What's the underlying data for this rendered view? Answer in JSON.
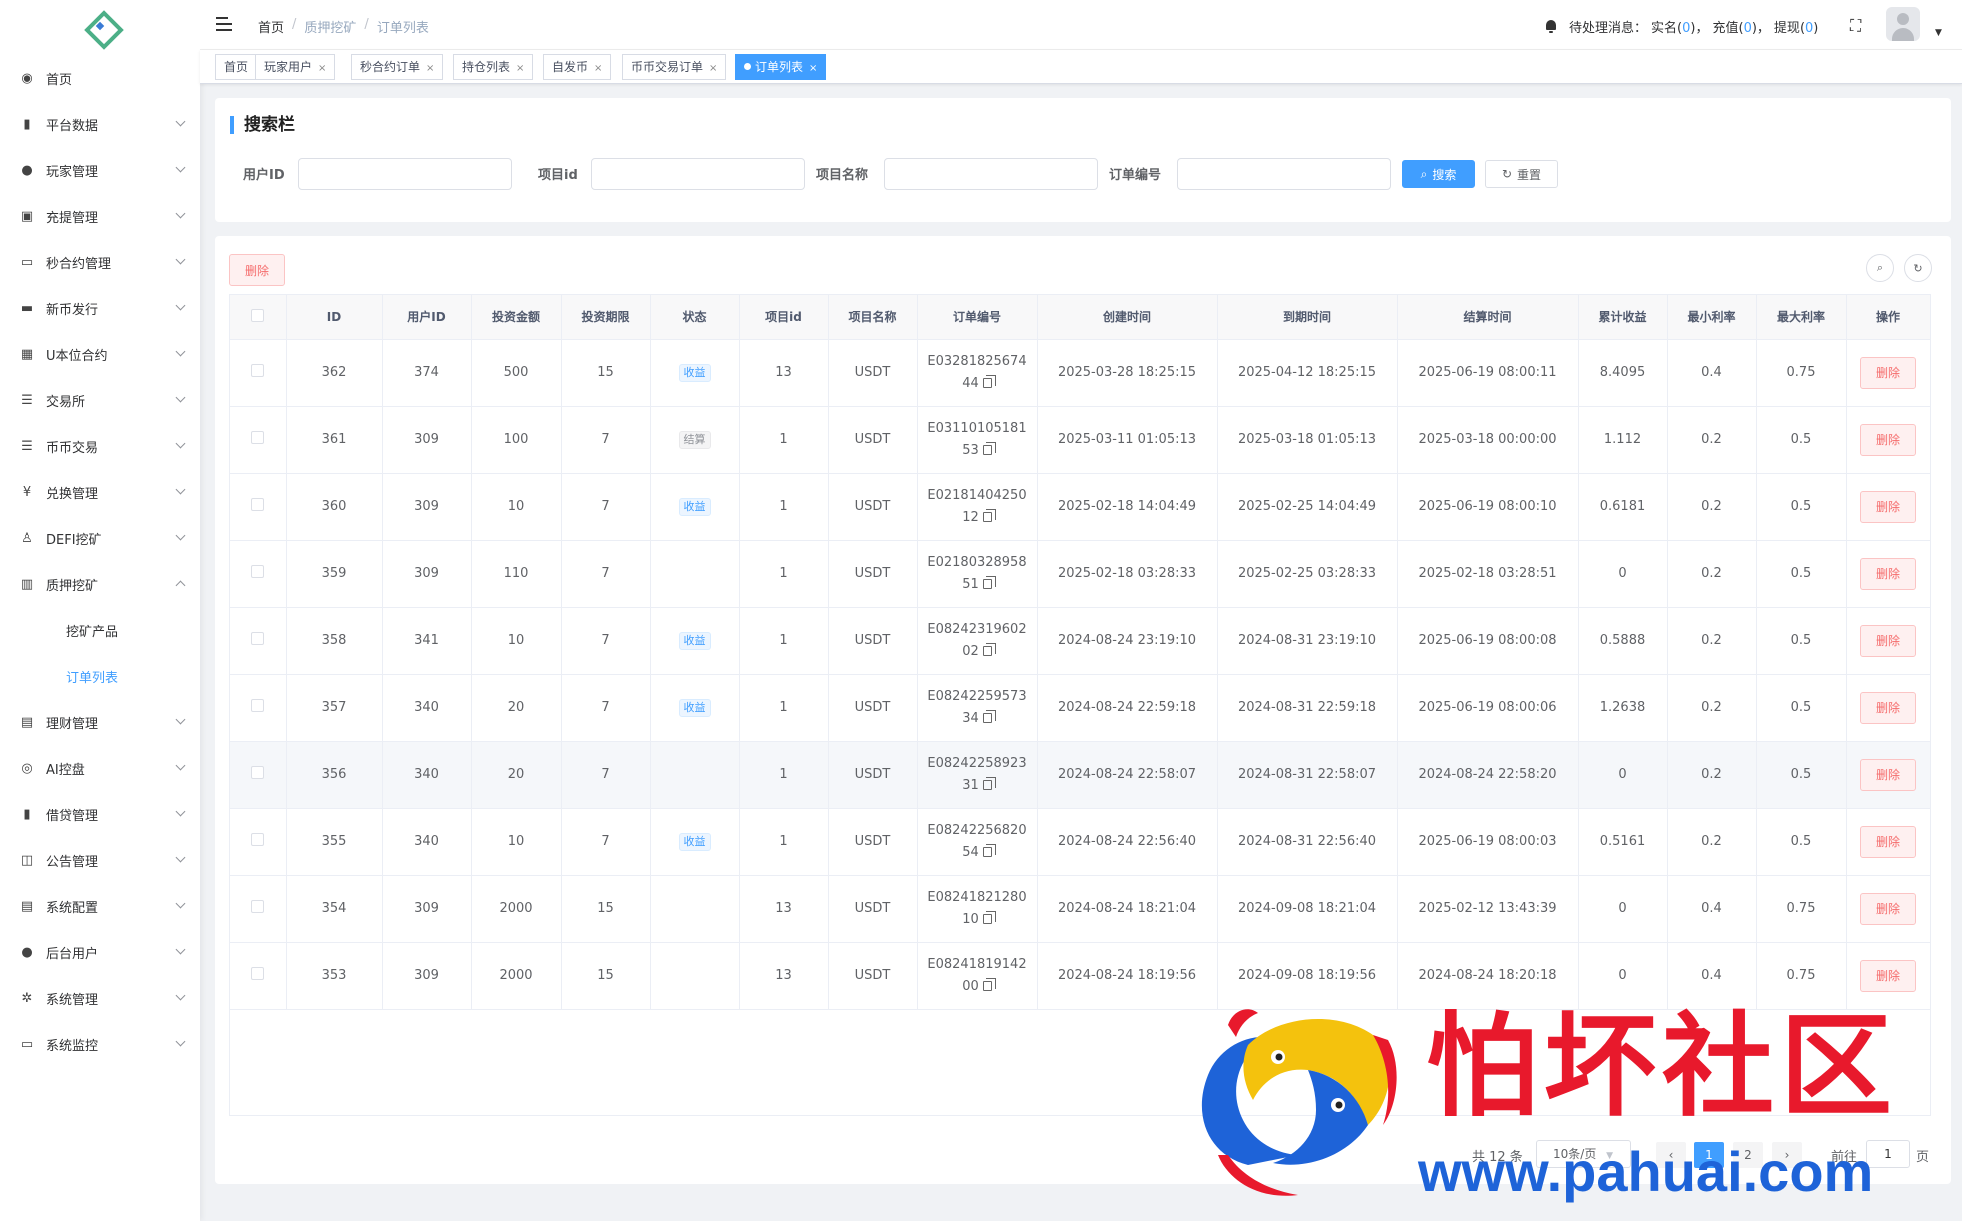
{
  "sidebar": {
    "items": [
      {
        "label": "首页",
        "icon": "dashboard-icon",
        "glyph": "◉",
        "expandable": false
      },
      {
        "label": "平台数据",
        "icon": "book-icon",
        "glyph": "▮",
        "expandable": true
      },
      {
        "label": "玩家管理",
        "icon": "user-icon",
        "glyph": "●",
        "expandable": true
      },
      {
        "label": "充提管理",
        "icon": "copy-icon",
        "glyph": "▣",
        "expandable": true
      },
      {
        "label": "秒合约管理",
        "icon": "monitor-icon",
        "glyph": "▭",
        "expandable": true
      },
      {
        "label": "新币发行",
        "icon": "money-icon",
        "glyph": "▬",
        "expandable": true
      },
      {
        "label": "U本位合约",
        "icon": "grid-icon",
        "glyph": "▦",
        "expandable": true
      },
      {
        "label": "交易所",
        "icon": "list-icon",
        "glyph": "☰",
        "expandable": true
      },
      {
        "label": "币币交易",
        "icon": "list-icon",
        "glyph": "☰",
        "expandable": true
      },
      {
        "label": "兑换管理",
        "icon": "yen-icon",
        "glyph": "¥",
        "expandable": true
      },
      {
        "label": "DEFI挖矿",
        "icon": "user-group-icon",
        "glyph": "♙",
        "expandable": true
      },
      {
        "label": "质押挖矿",
        "icon": "bar-chart-icon",
        "glyph": "▥",
        "expandable": true,
        "open": true
      }
    ],
    "sub_items": [
      {
        "label": "挖矿产品",
        "active": false
      },
      {
        "label": "订单列表",
        "active": true
      }
    ],
    "items_after": [
      {
        "label": "理财管理",
        "icon": "document-icon",
        "glyph": "▤",
        "expandable": true
      },
      {
        "label": "AI控盘",
        "icon": "robot-icon",
        "glyph": "◎",
        "expandable": true
      },
      {
        "label": "借贷管理",
        "icon": "book-icon",
        "glyph": "▮",
        "expandable": true
      },
      {
        "label": "公告管理",
        "icon": "open-book-icon",
        "glyph": "◫",
        "expandable": true
      },
      {
        "label": "系统配置",
        "icon": "document-icon",
        "glyph": "▤",
        "expandable": true
      },
      {
        "label": "后台用户",
        "icon": "users-icon",
        "glyph": "●",
        "expandable": true
      },
      {
        "label": "系统管理",
        "icon": "gear-icon",
        "glyph": "✲",
        "expandable": true
      },
      {
        "label": "系统监控",
        "icon": "monitor-icon",
        "glyph": "▭",
        "expandable": true
      }
    ]
  },
  "header": {
    "breadcrumb": [
      "首页",
      "质押挖矿",
      "订单列表"
    ],
    "pending_label": "待处理消息：",
    "pending_items": [
      {
        "label": "实名",
        "count": "0"
      },
      {
        "label": "充值",
        "count": "0"
      },
      {
        "label": "提现",
        "count": "0"
      }
    ]
  },
  "tags": [
    {
      "label": "首页",
      "closable": false,
      "active": false
    },
    {
      "label": "玩家用户",
      "closable": true,
      "active": false
    },
    {
      "label": "秒合约订单",
      "closable": true,
      "active": false
    },
    {
      "label": "持仓列表",
      "closable": true,
      "active": false
    },
    {
      "label": "自发币",
      "closable": true,
      "active": false
    },
    {
      "label": "币币交易订单",
      "closable": true,
      "active": false
    },
    {
      "label": "订单列表",
      "closable": true,
      "active": true
    }
  ],
  "search": {
    "title": "搜索栏",
    "fields": [
      {
        "label": "用户ID",
        "value": ""
      },
      {
        "label": "项目id",
        "value": ""
      },
      {
        "label": "项目名称",
        "value": ""
      },
      {
        "label": "订单编号",
        "value": ""
      }
    ],
    "search_label": "搜索",
    "reset_label": "重置"
  },
  "toolbar": {
    "delete_label": "删除"
  },
  "table": {
    "columns": [
      "ID",
      "用户ID",
      "投资金额",
      "投资期限",
      "状态",
      "项目id",
      "项目名称",
      "订单编号",
      "创建时间",
      "到期时间",
      "结算时间",
      "累计收益",
      "最小利率",
      "最大利率",
      "操作"
    ],
    "action_label": "删除",
    "rows": [
      {
        "id": "362",
        "user_id": "374",
        "amount": "500",
        "term": "15",
        "status": "收益",
        "status_type": "income",
        "project_id": "13",
        "project_name": "USDT",
        "order_no_1": "E03281825674",
        "order_no_2": "44",
        "created": "2025-03-28 18:25:15",
        "expires": "2025-04-12 18:25:15",
        "settled": "2025-06-19 08:00:11",
        "profit": "8.4095",
        "min_rate": "0.4",
        "max_rate": "0.75"
      },
      {
        "id": "361",
        "user_id": "309",
        "amount": "100",
        "term": "7",
        "status": "结算",
        "status_type": "settle",
        "project_id": "1",
        "project_name": "USDT",
        "order_no_1": "E03110105181",
        "order_no_2": "53",
        "created": "2025-03-11 01:05:13",
        "expires": "2025-03-18 01:05:13",
        "settled": "2025-03-18 00:00:00",
        "profit": "1.112",
        "min_rate": "0.2",
        "max_rate": "0.5"
      },
      {
        "id": "360",
        "user_id": "309",
        "amount": "10",
        "term": "7",
        "status": "收益",
        "status_type": "income",
        "project_id": "1",
        "project_name": "USDT",
        "order_no_1": "E02181404250",
        "order_no_2": "12",
        "created": "2025-02-18 14:04:49",
        "expires": "2025-02-25 14:04:49",
        "settled": "2025-06-19 08:00:10",
        "profit": "0.6181",
        "min_rate": "0.2",
        "max_rate": "0.5"
      },
      {
        "id": "359",
        "user_id": "309",
        "amount": "110",
        "term": "7",
        "status": "",
        "status_type": "",
        "project_id": "1",
        "project_name": "USDT",
        "order_no_1": "E02180328958",
        "order_no_2": "51",
        "created": "2025-02-18 03:28:33",
        "expires": "2025-02-25 03:28:33",
        "settled": "2025-02-18 03:28:51",
        "profit": "0",
        "min_rate": "0.2",
        "max_rate": "0.5"
      },
      {
        "id": "358",
        "user_id": "341",
        "amount": "10",
        "term": "7",
        "status": "收益",
        "status_type": "income",
        "project_id": "1",
        "project_name": "USDT",
        "order_no_1": "E08242319602",
        "order_no_2": "02",
        "created": "2024-08-24 23:19:10",
        "expires": "2024-08-31 23:19:10",
        "settled": "2025-06-19 08:00:08",
        "profit": "0.5888",
        "min_rate": "0.2",
        "max_rate": "0.5"
      },
      {
        "id": "357",
        "user_id": "340",
        "amount": "20",
        "term": "7",
        "status": "收益",
        "status_type": "income",
        "project_id": "1",
        "project_name": "USDT",
        "order_no_1": "E08242259573",
        "order_no_2": "34",
        "created": "2024-08-24 22:59:18",
        "expires": "2024-08-31 22:59:18",
        "settled": "2025-06-19 08:00:06",
        "profit": "1.2638",
        "min_rate": "0.2",
        "max_rate": "0.5"
      },
      {
        "id": "356",
        "user_id": "340",
        "amount": "20",
        "term": "7",
        "status": "",
        "status_type": "",
        "project_id": "1",
        "project_name": "USDT",
        "order_no_1": "E08242258923",
        "order_no_2": "31",
        "created": "2024-08-24 22:58:07",
        "expires": "2024-08-31 22:58:07",
        "settled": "2024-08-24 22:58:20",
        "profit": "0",
        "min_rate": "0.2",
        "max_rate": "0.5",
        "hover": true
      },
      {
        "id": "355",
        "user_id": "340",
        "amount": "10",
        "term": "7",
        "status": "收益",
        "status_type": "income",
        "project_id": "1",
        "project_name": "USDT",
        "order_no_1": "E08242256820",
        "order_no_2": "54",
        "created": "2024-08-24 22:56:40",
        "expires": "2024-08-31 22:56:40",
        "settled": "2025-06-19 08:00:03",
        "profit": "0.5161",
        "min_rate": "0.2",
        "max_rate": "0.5"
      },
      {
        "id": "354",
        "user_id": "309",
        "amount": "2000",
        "term": "15",
        "status": "",
        "status_type": "",
        "project_id": "13",
        "project_name": "USDT",
        "order_no_1": "E08241821280",
        "order_no_2": "10",
        "created": "2024-08-24 18:21:04",
        "expires": "2024-09-08 18:21:04",
        "settled": "2025-02-12 13:43:39",
        "profit": "0",
        "min_rate": "0.4",
        "max_rate": "0.75"
      },
      {
        "id": "353",
        "user_id": "309",
        "amount": "2000",
        "term": "15",
        "status": "",
        "status_type": "",
        "project_id": "13",
        "project_name": "USDT",
        "order_no_1": "E08241819142",
        "order_no_2": "00",
        "created": "2024-08-24 18:19:56",
        "expires": "2024-09-08 18:19:56",
        "settled": "2024-08-24 18:20:18",
        "profit": "0",
        "min_rate": "0.4",
        "max_rate": "0.75"
      }
    ]
  },
  "pagination": {
    "total_text": "共 12 条",
    "page_size": "10条/页",
    "pages": [
      "1",
      "2"
    ],
    "current_page": "1",
    "goto_label": "前往",
    "goto_value": "1",
    "page_unit": "页"
  },
  "watermark": {
    "title": "怕坏社区",
    "url": "www.pahuai.com"
  },
  "colors": {
    "primary": "#409eff",
    "danger": "#f56c6c",
    "watermark_red": "#e8192c",
    "watermark_blue": "#1e63d8"
  }
}
